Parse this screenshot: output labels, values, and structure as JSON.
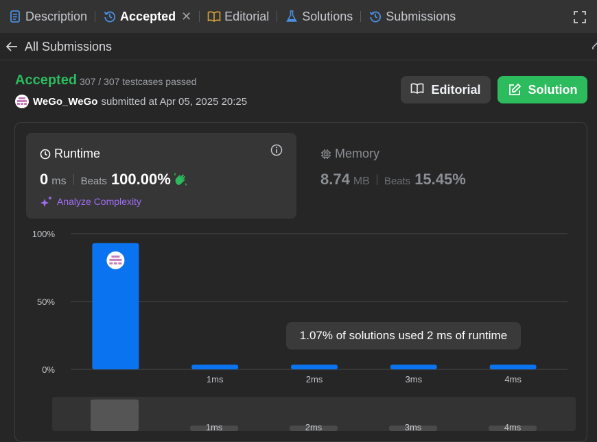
{
  "tabs": [
    {
      "label": "Description",
      "icon": "description-icon",
      "active": false
    },
    {
      "label": "Accepted",
      "icon": "history-icon",
      "active": true
    },
    {
      "label": "Editorial",
      "icon": "book-icon",
      "active": false
    },
    {
      "label": "Solutions",
      "icon": "flask-icon",
      "active": false
    },
    {
      "label": "Submissions",
      "icon": "history-icon",
      "active": false
    }
  ],
  "back_label": "All Submissions",
  "submission": {
    "status": "Accepted",
    "testcases": "307 / 307 testcases passed",
    "username": "WeGo_WeGo",
    "submitted_text": "submitted at Apr 05, 2025 20:25"
  },
  "buttons": {
    "editorial": "Editorial",
    "solution": "Solution"
  },
  "runtime": {
    "title": "Runtime",
    "value": "0",
    "unit": "ms",
    "beats_label": "Beats",
    "beats": "100.00%",
    "analyze": "Analyze Complexity"
  },
  "memory": {
    "title": "Memory",
    "value": "8.74",
    "unit": "MB",
    "beats_label": "Beats",
    "beats": "15.45%"
  },
  "colors": {
    "accepted": "#2cbb5d",
    "bar": "#0a74f0",
    "analyze": "#a06ef5"
  },
  "tooltip": "1.07% of solutions used 2 ms of runtime",
  "chart_data": {
    "type": "bar",
    "categories": [
      "0ms",
      "1ms",
      "2ms",
      "3ms",
      "4ms"
    ],
    "tick_labels": [
      "",
      "1ms",
      "2ms",
      "3ms",
      "4ms"
    ],
    "values": [
      93,
      3.5,
      3.5,
      3.5,
      3.5
    ],
    "y_ticks": [
      "0%",
      "50%",
      "100%"
    ],
    "ylim": [
      0,
      100
    ],
    "grid": true,
    "user_category": "0ms"
  },
  "overview": {
    "tick_labels": [
      "1ms",
      "2ms",
      "3ms",
      "4ms"
    ]
  }
}
